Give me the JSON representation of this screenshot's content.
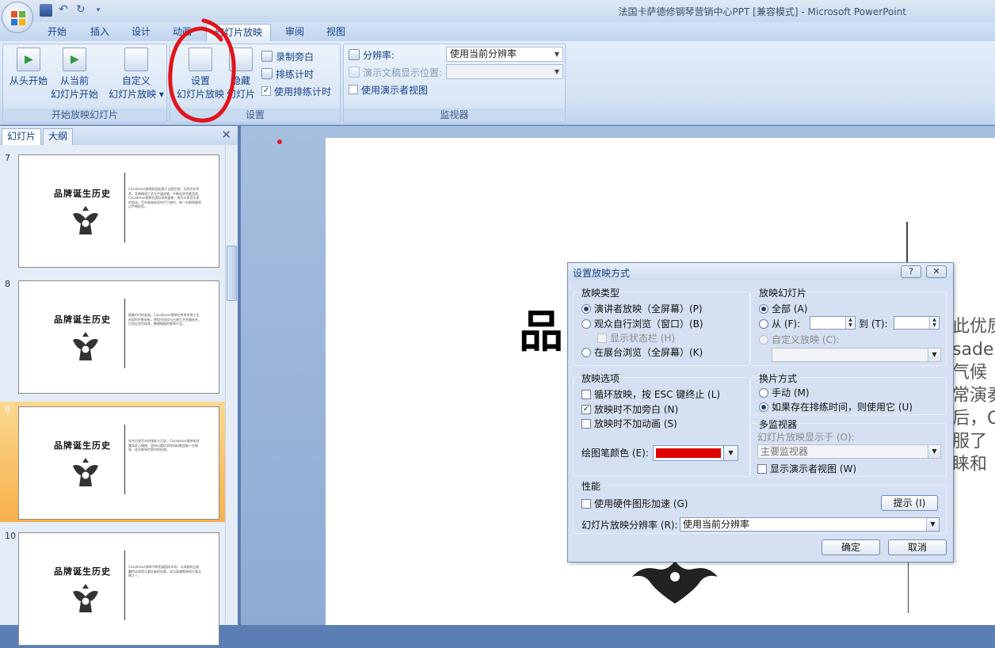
{
  "window": {
    "title": "法国卡萨德修钢琴营销中心PPT [兼容模式] - Microsoft PowerPoint"
  },
  "ribbon_tabs": [
    {
      "label": "开始"
    },
    {
      "label": "插入"
    },
    {
      "label": "设计"
    },
    {
      "label": "动画"
    },
    {
      "label": "幻灯片放映"
    },
    {
      "label": "审阅"
    },
    {
      "label": "视图"
    }
  ],
  "active_tab": "幻灯片放映",
  "ribbon": {
    "start_group": {
      "label": "开始放映幻灯片",
      "from_beginning": "从头开始",
      "from_current_1": "从当前",
      "from_current_2": "幻灯片开始",
      "custom_1": "自定义",
      "custom_2": "幻灯片放映 ▾"
    },
    "setup_group": {
      "label": "设置",
      "setup_1": "设置",
      "setup_2": "幻灯片放映",
      "hide_1": "隐藏",
      "hide_2": "幻灯片",
      "record_narration": "录制旁白",
      "rehearse_timings": "排练计时",
      "use_rehearsed": "使用排练计时",
      "use_rehearsed_checked": true
    },
    "monitors_group": {
      "label": "监视器",
      "resolution_label": "分辨率:",
      "resolution_value": "使用当前分辨率",
      "show_on_label": "演示文稿显示位置:",
      "show_on_value": "",
      "presenter_view": "使用演示者视图",
      "presenter_view_checked": false
    }
  },
  "slides_pane": {
    "tabs": [
      {
        "label": "幻灯片"
      },
      {
        "label": "大纲"
      }
    ],
    "close": "✕",
    "slides": [
      {
        "number": "7",
        "title": "品牌诞生历史",
        "text": "Casadesus钢琴制造起源于法国巴黎，历经百年传承，凭借精湛工艺与严谨态度，不断追求完美音质，Casadesus钢琴在国际享有盛誉，成为众多音乐家的首选。百年来始终坚持手工制作，每一台钢琴都经过严格检验。"
      },
      {
        "number": "8",
        "title": "品牌诞生历史",
        "text": "随着时代的发展，Casadesus钢琴在传承传统工艺的同时不断创新，将现代科技与古典工艺完美结合，打造出音色纯净、触感细腻的钢琴产品。"
      },
      {
        "number": "9",
        "title": "品牌诞生历史",
        "text": "如今历经百年的锤炼与沉淀，Casadesus钢琴依然秉承匠心精神，坚持以最优质的材料制造每一台钢琴，成为钢琴世界中的经典。"
      },
      {
        "number": "10",
        "title": "品牌诞生历史",
        "text": "Casadesus钢琴不断拓展国际市场，以卓越的品质赢得全球音乐爱好者的信赖，成为高端钢琴的代表品牌之一。"
      }
    ],
    "selected": "9"
  },
  "slide_canvas": {
    "big_glyph": "品",
    "text_lines": "此优质\nsade\n气候\n常演奏\n后，C\n服了\n睐和"
  },
  "dialog": {
    "title": "设置放映方式",
    "help": "?",
    "close": "✕",
    "show_type": {
      "header": "放映类型",
      "presenter": "演讲者放映（全屏幕）(P)",
      "individual": "观众自行浏览（窗口）(B)",
      "show_scrollbar": "显示状态栏 (H)",
      "kiosk": "在展台浏览（全屏幕）(K)",
      "selected": "presenter"
    },
    "show_slides": {
      "header": "放映幻灯片",
      "all": "全部 (A)",
      "from": "从 (F):",
      "to": "到 (T):",
      "from_value": "",
      "to_value": "",
      "custom": "自定义放映 (C):",
      "custom_value": "",
      "selected": "all"
    },
    "show_options": {
      "header": "放映选项",
      "loop": "循环放映，按 ESC 键终止 (L)",
      "loop_checked": false,
      "no_narration": "放映时不加旁白 (N)",
      "no_narration_checked": true,
      "no_animation": "放映时不加动画 (S)",
      "no_animation_checked": false,
      "pen_color_label": "绘图笔颜色 (E):",
      "pen_color": "#e00000"
    },
    "advance": {
      "header": "换片方式",
      "manual": "手动 (M)",
      "timings": "如果存在排练时间，则使用它 (U)",
      "selected": "timings"
    },
    "multi_monitor": {
      "header": "多监视器",
      "show_on_label": "幻灯片放映显示于 (O):",
      "show_on_value": "主要监视器",
      "presenter_view": "显示演示者视图 (W)",
      "presenter_view_checked": false
    },
    "performance": {
      "header": "性能",
      "hw_accel": "使用硬件图形加速 (G)",
      "hw_accel_checked": false,
      "tips": "提示 (I)",
      "resolution_label": "幻灯片放映分辨率 (R):",
      "resolution_value": "使用当前分辨率"
    },
    "ok": "确定",
    "cancel": "取消"
  }
}
